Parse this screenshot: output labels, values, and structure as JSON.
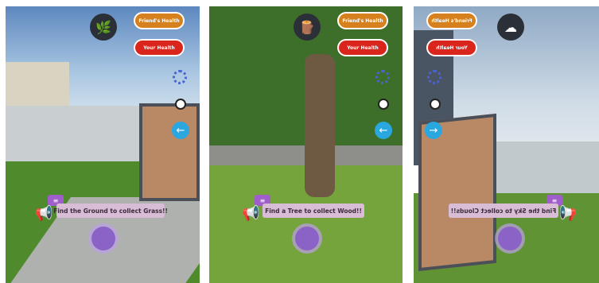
{
  "panels": [
    {
      "resource_icon": "grass-icon",
      "resource_glyph": "🌿",
      "friends_health_label": "Friend's Health",
      "your_health_label": "Your Health",
      "instruction": "Find the Ground to collect Grass!!"
    },
    {
      "resource_icon": "wood-icon",
      "resource_glyph": "🪵",
      "friends_health_label": "Friend's Health",
      "your_health_label": "Your Health",
      "instruction": "Find a Tree to collect Wood!!"
    },
    {
      "resource_icon": "cloud-icon",
      "resource_glyph": "☁",
      "friends_health_label": "Friend's Health",
      "your_health_label": "Your Health",
      "instruction": "Find the Sky to collect Clouds!!"
    }
  ],
  "glyphs": {
    "arrow": "←",
    "arrow_right": "→",
    "megaphone": "📢",
    "speech": "≡"
  },
  "colors": {
    "friend": "#d7801e",
    "your": "#d9251c",
    "accent": "#8b63c7"
  }
}
